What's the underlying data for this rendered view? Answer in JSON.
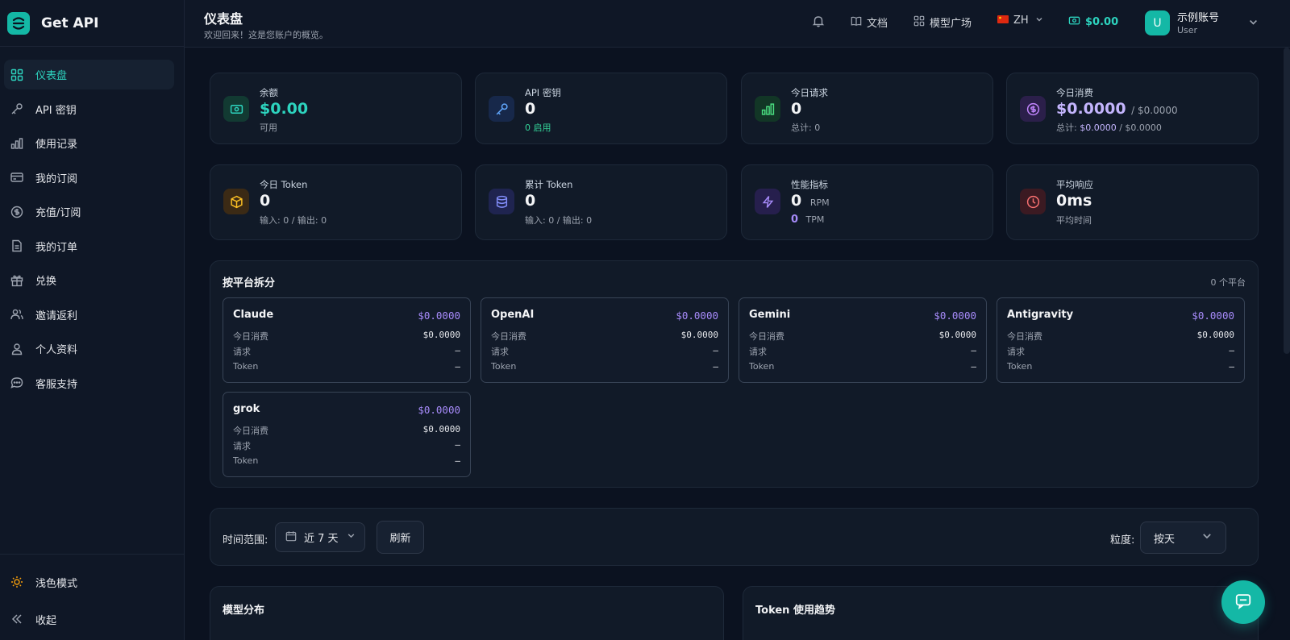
{
  "brand": {
    "name": "Get API"
  },
  "header": {
    "title": "仪表盘",
    "subtitle": "欢迎回来！这是您账户的概览。",
    "docs": "文档",
    "models": "模型广场",
    "lang": "ZH",
    "balance": "$0.00",
    "user_initial": "U",
    "user_name": "示例账号",
    "user_role": "User"
  },
  "sidebar": {
    "items": [
      {
        "label": "仪表盘",
        "icon": "grid-icon"
      },
      {
        "label": "API 密钥",
        "icon": "key-icon"
      },
      {
        "label": "使用记录",
        "icon": "bar-chart-icon"
      },
      {
        "label": "我的订阅",
        "icon": "card-icon"
      },
      {
        "label": "充值/订阅",
        "icon": "coin-icon"
      },
      {
        "label": "我的订单",
        "icon": "document-icon"
      },
      {
        "label": "兑换",
        "icon": "gift-icon"
      },
      {
        "label": "邀请返利",
        "icon": "users-icon"
      },
      {
        "label": "个人资料",
        "icon": "user-icon"
      },
      {
        "label": "客服支持",
        "icon": "chat-icon"
      }
    ],
    "theme_toggle": "浅色模式",
    "collapse": "收起"
  },
  "stats": {
    "balance": {
      "label": "余额",
      "value": "$0.00",
      "sub": "可用"
    },
    "api_keys": {
      "label": "API 密钥",
      "value": "0",
      "sub": "0 启用"
    },
    "today_requests": {
      "label": "今日请求",
      "value": "0",
      "sub": "总计: 0"
    },
    "today_cost": {
      "label": "今日消费",
      "value": "$0.0000",
      "value_suffix": "/ $0.0000",
      "sub_prefix": "总计:",
      "sub_value": "$0.0000",
      "sub_suffix": "/ $0.0000"
    },
    "today_token": {
      "label": "今日 Token",
      "value": "0",
      "sub": "输入: 0 / 输出: 0"
    },
    "total_token": {
      "label": "累计 Token",
      "value": "0",
      "sub": "输入: 0 / 输出: 0"
    },
    "performance": {
      "label": "性能指标",
      "rpm_value": "0",
      "rpm_unit": "RPM",
      "tpm_value": "0",
      "tpm_unit": "TPM"
    },
    "avg_response": {
      "label": "平均响应",
      "value": "0ms",
      "sub": "平均时间"
    }
  },
  "platforms": {
    "title": "按平台拆分",
    "count": "0 个平台",
    "row_labels": {
      "cost": "今日消费",
      "requests": "请求",
      "token": "Token"
    },
    "items": [
      {
        "name": "Claude",
        "cost": "$0.0000",
        "today_cost": "$0.0000",
        "requests": "–",
        "token": "–"
      },
      {
        "name": "OpenAI",
        "cost": "$0.0000",
        "today_cost": "$0.0000",
        "requests": "–",
        "token": "–"
      },
      {
        "name": "Gemini",
        "cost": "$0.0000",
        "today_cost": "$0.0000",
        "requests": "–",
        "token": "–"
      },
      {
        "name": "Antigravity",
        "cost": "$0.0000",
        "today_cost": "$0.0000",
        "requests": "–",
        "token": "–"
      },
      {
        "name": "grok",
        "cost": "$0.0000",
        "today_cost": "$0.0000",
        "requests": "–",
        "token": "–"
      }
    ]
  },
  "controls": {
    "range_label": "时间范围:",
    "range_value": "近 7 天",
    "refresh": "刷新",
    "granularity_label": "粒度:",
    "granularity_value": "按天"
  },
  "charts": {
    "model_dist": "模型分布",
    "token_trend": "Token 使用趋势"
  },
  "colors": {
    "accent": "#2dd4bf",
    "purple": "#a78bfa",
    "background": "#0b1220"
  }
}
